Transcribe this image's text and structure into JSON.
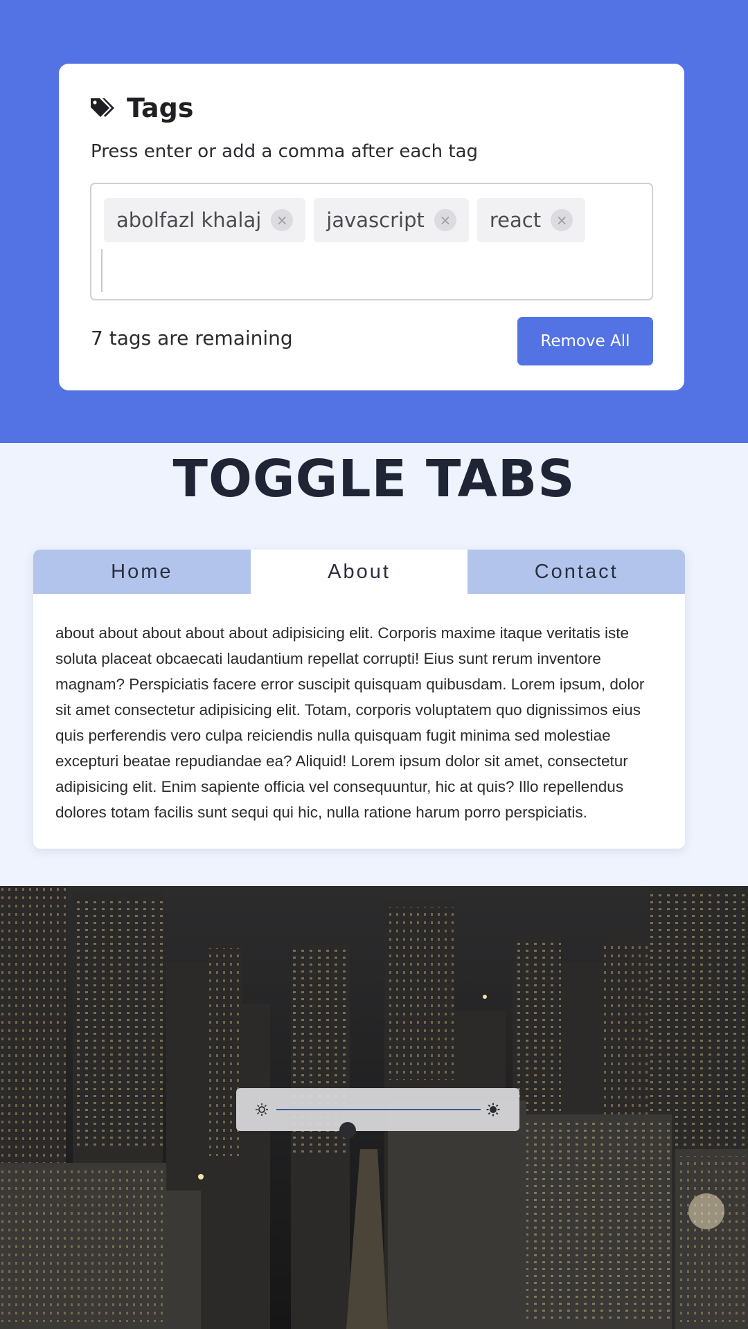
{
  "tags_widget": {
    "title": "Tags",
    "title_icon": "tag-icon",
    "hint": "Press enter or add a comma after each tag",
    "tags": [
      {
        "label": "abolfazl khalaj",
        "remove_glyph": "×"
      },
      {
        "label": "javascript",
        "remove_glyph": "×"
      },
      {
        "label": "react",
        "remove_glyph": "×"
      }
    ],
    "input_value": "",
    "remaining_text": "7 tags are remaining",
    "remove_all_label": "Remove All",
    "accent_color": "#5372e4"
  },
  "toggle_tabs": {
    "heading": "TOGGLE TABS",
    "tabs": [
      {
        "label": "Home",
        "active": false
      },
      {
        "label": "About",
        "active": true
      },
      {
        "label": "Contact",
        "active": false
      }
    ],
    "content": "about about about about about adipisicing elit. Corporis maxime itaque veritatis iste soluta placeat obcaecati laudantium repellat corrupti! Eius sunt rerum inventore magnam? Perspiciatis facere error suscipit quisquam quibusdam. Lorem ipsum, dolor sit amet consectetur adipisicing elit. Totam, corporis voluptatem quo dignissimos eius quis perferendis vero culpa reiciendis nulla quisquam fugit minima sed molestiae excepturi beatae repudiandae ea? Aliquid! Lorem ipsum dolor sit amet, consectetur adipisicing elit. Enim sapiente officia vel consequuntur, hic at quis? Illo repellendus dolores totam facilis sunt sequi qui hic, nulla ratione harum porro perspiciatis.",
    "tab_inactive_color": "#b3c4ec"
  },
  "brightness": {
    "background": "night-city-photo",
    "min_icon": "sun-small-icon",
    "max_icon": "sun-large-icon",
    "value_fraction": 0.35
  }
}
